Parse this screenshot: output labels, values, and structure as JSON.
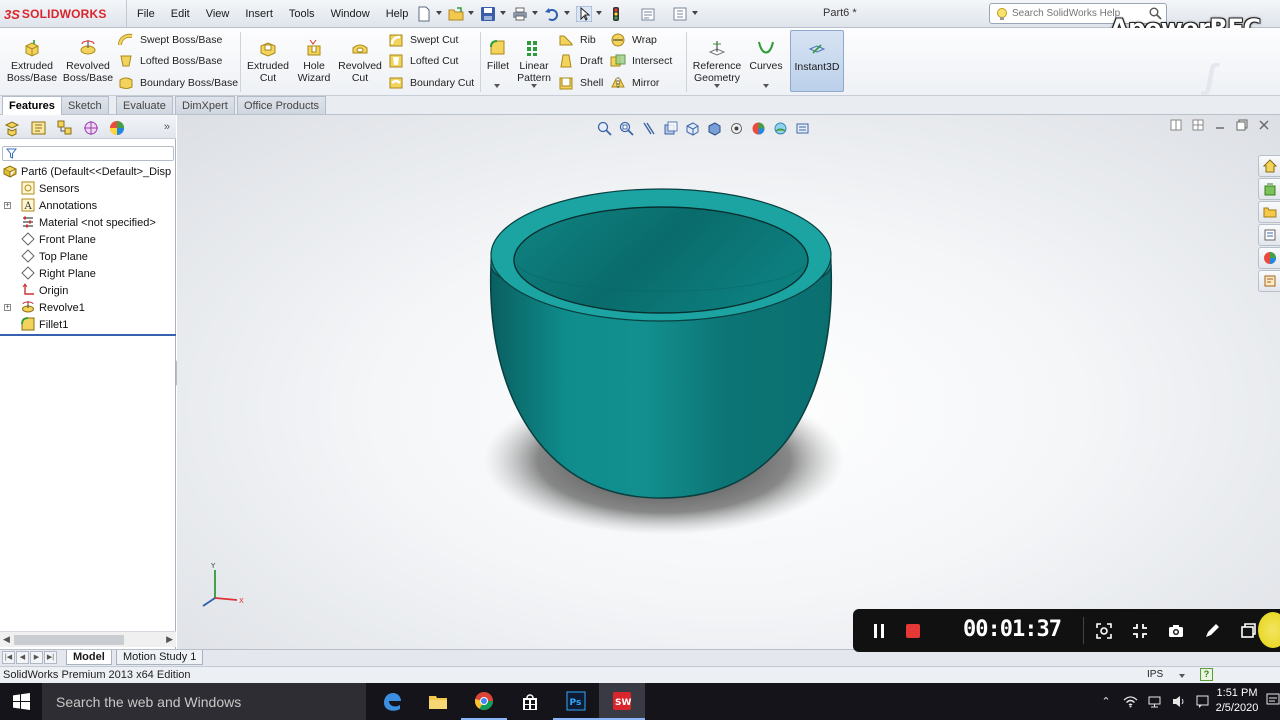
{
  "app": {
    "logo_ds": "3S",
    "logo_brand": "SOLIDWORKS",
    "document_title": "Part6 *",
    "watermark": "ApowerREC"
  },
  "menu": [
    "File",
    "Edit",
    "View",
    "Insert",
    "Tools",
    "Window",
    "Help"
  ],
  "help_search": {
    "placeholder": "Search SolidWorks Help"
  },
  "commands": {
    "extruded_boss": "Extruded Boss/Base",
    "revolved_boss": "Revolved Boss/Base",
    "swept_boss": "Swept Boss/Base",
    "lofted_boss": "Lofted Boss/Base",
    "boundary_boss": "Boundary Boss/Base",
    "extruded_cut": "Extruded Cut",
    "hole_wizard": "Hole Wizard",
    "revolved_cut": "Revolved Cut",
    "swept_cut": "Swept Cut",
    "lofted_cut": "Lofted Cut",
    "boundary_cut": "Boundary Cut",
    "fillet": "Fillet",
    "linear_pattern": "Linear Pattern",
    "rib": "Rib",
    "draft": "Draft",
    "shell": "Shell",
    "wrap": "Wrap",
    "intersect": "Intersect",
    "mirror": "Mirror",
    "reference_geometry": "Reference Geometry",
    "curves": "Curves",
    "instant3d": "Instant3D"
  },
  "tabs": [
    "Features",
    "Sketch",
    "Evaluate",
    "DimXpert",
    "Office Products"
  ],
  "active_tab": "Features",
  "feature_tree": {
    "root": "Part6  (Default<<Default>_Disp",
    "items": [
      {
        "label": "Sensors",
        "icon": "sensors-icon",
        "expandable": false
      },
      {
        "label": "Annotations",
        "icon": "annotations-icon",
        "expandable": true
      },
      {
        "label": "Material <not specified>",
        "icon": "material-icon",
        "expandable": false
      },
      {
        "label": "Front Plane",
        "icon": "plane-icon",
        "expandable": false
      },
      {
        "label": "Top Plane",
        "icon": "plane-icon",
        "expandable": false
      },
      {
        "label": "Right Plane",
        "icon": "plane-icon",
        "expandable": false
      },
      {
        "label": "Origin",
        "icon": "origin-icon",
        "expandable": false
      },
      {
        "label": "Revolve1",
        "icon": "revolve-icon",
        "expandable": true
      },
      {
        "label": "Fillet1",
        "icon": "fillet-icon",
        "expandable": false
      }
    ]
  },
  "bottom_tabs": [
    "Model",
    "Motion Study 1"
  ],
  "status": {
    "text": "SolidWorks Premium 2013 x64 Edition",
    "units": "IPS"
  },
  "recorder": {
    "timer": "00:01:37",
    "controls": [
      "pause-icon",
      "stop-icon",
      "screenshot-region-icon",
      "fullscreen-icon",
      "camera-icon",
      "pen-icon",
      "minimize-icon"
    ]
  },
  "taskbar": {
    "search_placeholder": "Search the web and Windows",
    "apps": [
      "edge-icon",
      "file-explorer-icon",
      "chrome-icon",
      "store-icon",
      "photoshop-icon",
      "solidworks-icon"
    ],
    "time": "1:51 PM",
    "date": "2/5/2020"
  },
  "colors": {
    "model": "#0e7f7f",
    "accent_red": "#d9262c",
    "taskbar": "#14141a"
  }
}
